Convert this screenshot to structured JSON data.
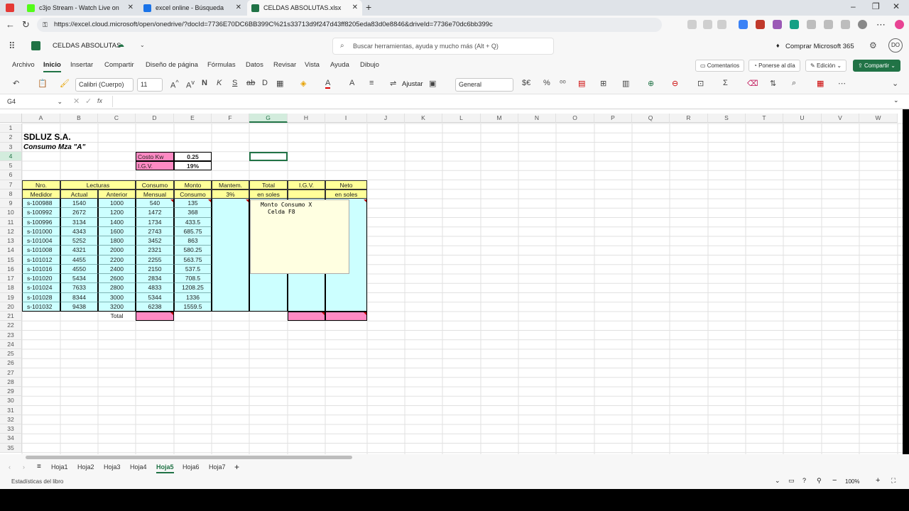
{
  "browser": {
    "tabs": [
      {
        "title": "c3jo Stream - Watch Live on",
        "color": "#7b4dd8"
      },
      {
        "title": "excel online - Búsqueda",
        "color": "#1a73e8"
      },
      {
        "title": "CELDAS ABSOLUTAS.xlsx",
        "color": "#217346"
      }
    ],
    "url": "https://excel.cloud.microsoft/open/onedrive/?docId=7736E70DC6BB399C%21s33713d9f247d43ff8205eda83d0e8846&driveId=7736e70dc6bb399c"
  },
  "app": {
    "filename": "CELDAS ABSOLUTAS",
    "search_placeholder": "Buscar herramientas, ayuda y mucho más (Alt + Q)",
    "buy": "Comprar Microsoft 365",
    "user_initials": "DO"
  },
  "ribbon": {
    "tabs": [
      "Archivo",
      "Inicio",
      "Insertar",
      "Compartir",
      "Diseño de página",
      "Fórmulas",
      "Datos",
      "Revisar",
      "Vista",
      "Ayuda",
      "Dibujo"
    ],
    "comments": "Comentarios",
    "catchup": "Ponerse al día",
    "edit": "Edición",
    "share": "Compartir"
  },
  "toolbar": {
    "font": "Calibri (Cuerpo)",
    "size": "11",
    "wrap": "Ajustar",
    "format": "General"
  },
  "formula": {
    "namebox": "G4",
    "fx": "fx"
  },
  "columns": [
    "A",
    "B",
    "C",
    "D",
    "E",
    "F",
    "G",
    "H",
    "I",
    "J",
    "K",
    "L",
    "M",
    "N",
    "O",
    "P",
    "Q",
    "R",
    "S",
    "T",
    "U",
    "V",
    "W"
  ],
  "sheet": {
    "company": "SDLUZ S.A.",
    "subtitle": "Consumo Mza \"A\"",
    "costo_label": "Costo Kw",
    "costo_value": "0.25",
    "igv_label": "I.G.V.",
    "igv_value": "19%",
    "headers": {
      "nro1": "Nro.",
      "nro2": "Medidor",
      "lect": "Lecturas",
      "actual": "Actual",
      "anterior": "Anterior",
      "cons1": "Consumo",
      "cons2": "Mensual",
      "monto1": "Monto",
      "monto2": "Consumo",
      "mant1": "Mantem.",
      "mant2": "3%",
      "total1": "Total",
      "total2": "en soles",
      "igv": "I.G.V.",
      "neto1": "Neto",
      "neto2": "en soles"
    },
    "rows": [
      [
        "s-100988",
        "1540",
        "1000",
        "540",
        "135"
      ],
      [
        "s-100992",
        "2672",
        "1200",
        "1472",
        "368"
      ],
      [
        "s-100996",
        "3134",
        "1400",
        "1734",
        "433.5"
      ],
      [
        "s-101000",
        "4343",
        "1600",
        "2743",
        "685.75"
      ],
      [
        "s-101004",
        "5252",
        "1800",
        "3452",
        "863"
      ],
      [
        "s-101008",
        "4321",
        "2000",
        "2321",
        "580.25"
      ],
      [
        "s-101012",
        "4455",
        "2200",
        "2255",
        "563.75"
      ],
      [
        "s-101016",
        "4550",
        "2400",
        "2150",
        "537.5"
      ],
      [
        "s-101020",
        "5434",
        "2600",
        "2834",
        "708.5"
      ],
      [
        "s-101024",
        "7633",
        "2800",
        "4833",
        "1208.25"
      ],
      [
        "s-101028",
        "8344",
        "3000",
        "5344",
        "1336"
      ],
      [
        "s-101032",
        "9438",
        "3200",
        "6238",
        "1559.5"
      ]
    ],
    "total_label": "Total",
    "comment_title": "Monto Consumo   X",
    "comment_text": "Celda  F8"
  },
  "sheets": [
    "Hoja1",
    "Hoja2",
    "Hoja3",
    "Hoja4",
    "Hoja5",
    "Hoja6",
    "Hoja7"
  ],
  "status": {
    "left": "Estadísticas del libro",
    "zoom": "100%"
  }
}
